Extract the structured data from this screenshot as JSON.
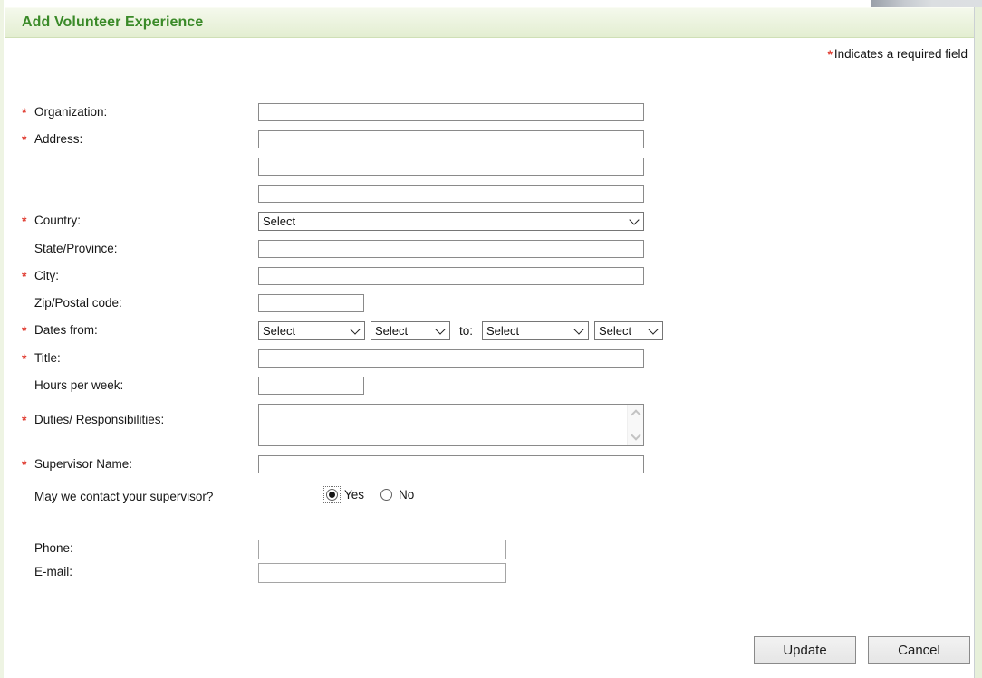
{
  "header": {
    "title": "Add Volunteer Experience"
  },
  "required_note": {
    "marker": "*",
    "text": "Indicates a required field"
  },
  "form": {
    "required_marker": "*",
    "fields": {
      "organization": {
        "label": "Organization:",
        "required": true,
        "value": ""
      },
      "address": {
        "label": "Address:",
        "required": true,
        "value1": "",
        "value2": "",
        "value3": ""
      },
      "country": {
        "label": "Country:",
        "required": true,
        "selected": "Select"
      },
      "state": {
        "label": "State/Province:",
        "required": false,
        "value": ""
      },
      "city": {
        "label": "City:",
        "required": true,
        "value": ""
      },
      "zip": {
        "label": "Zip/Postal code:",
        "required": false,
        "value": ""
      },
      "dates": {
        "label": "Dates from:",
        "required": true,
        "to_label": "to:",
        "from_month": "Select",
        "from_year": "Select",
        "to_month": "Select",
        "to_year": "Select"
      },
      "title": {
        "label": "Title:",
        "required": true,
        "value": ""
      },
      "hours": {
        "label": "Hours per week:",
        "required": false,
        "value": ""
      },
      "duties": {
        "label": "Duties/ Responsibilities:",
        "required": true,
        "value": ""
      },
      "supervisor": {
        "label": "Supervisor Name:",
        "required": true,
        "value": ""
      },
      "contact_supervisor": {
        "label": "May we contact your supervisor?",
        "options": [
          {
            "label": "Yes",
            "selected": true
          },
          {
            "label": "No",
            "selected": false
          }
        ]
      },
      "phone": {
        "label": "Phone:",
        "required": false,
        "value": ""
      },
      "email": {
        "label": "E-mail:",
        "required": false,
        "value": ""
      }
    }
  },
  "buttons": {
    "update": "Update",
    "cancel": "Cancel"
  },
  "colors": {
    "header_bg_top": "#f5f9ed",
    "header_bg_bottom": "#e3eed1",
    "header_text": "#3a8a28",
    "required_red": "#e03c31",
    "edge_strip_green": "#e7f0da",
    "input_border": "#8a8a8a",
    "button_bg": "#ececec"
  }
}
